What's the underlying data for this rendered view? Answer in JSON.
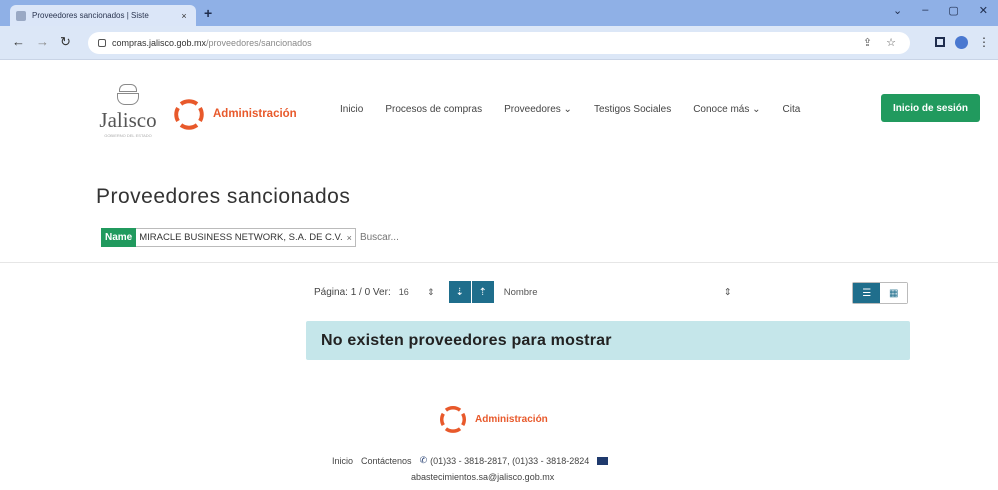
{
  "browser": {
    "tab_title": "Proveedores sancionados | Siste",
    "tab_close": "×",
    "new_tab": "+",
    "url_host": "compras.jalisco.gob.mx",
    "url_path": "/proveedores/sancionados",
    "window_controls": [
      "⌄",
      "–",
      "▢",
      "✕"
    ]
  },
  "header": {
    "jalisco_logo_text": "Jalisco",
    "jalisco_logo_sub": "GOBIERNO DEL ESTADO",
    "admin_logo_text": "Administración",
    "nav": [
      {
        "label": "Inicio"
      },
      {
        "label": "Procesos de compras"
      },
      {
        "label": "Proveedores ⌄"
      },
      {
        "label": "Testigos Sociales"
      },
      {
        "label": "Conoce más ⌄"
      },
      {
        "label": "Cita"
      }
    ],
    "login_label": "Inicio de sesión"
  },
  "page": {
    "title": "Proveedores sancionados",
    "filter": {
      "tag": "Name",
      "value": "MIRACLE BUSINESS NETWORK, S.A. DE C.V.",
      "remove": "×",
      "search_placeholder": "Buscar..."
    },
    "toolbar": {
      "pager": "Página: 1 / 0 Ver:",
      "per_page": "16",
      "per_page_arrow": "⇕",
      "sort_field": "Nombre",
      "sort_field_arrow": "⇕"
    },
    "empty_message": "No existen proveedores para mostrar"
  },
  "footer": {
    "admin_logo_text": "Administración",
    "link_home": "Inicio",
    "link_contact": "Contáctenos",
    "phones": "(01)33 - 3818-2817, (01)33 - 3818-2824",
    "email": "abastecimientos.sa@jalisco.gob.mx"
  },
  "colors": {
    "accent_green": "#219a5e",
    "accent_orange": "#e8592b",
    "accent_teal": "#1f6e8c",
    "alert_bg": "#c5e6ea"
  }
}
